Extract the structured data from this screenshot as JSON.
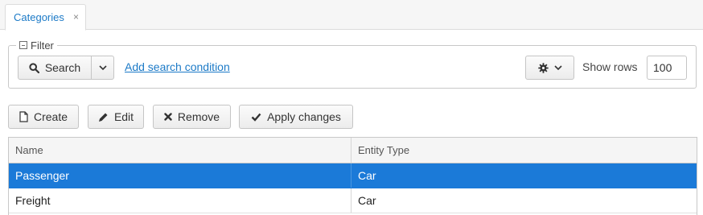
{
  "tab": {
    "label": "Categories",
    "close_glyph": "×"
  },
  "filter": {
    "legend": "Filter",
    "search_button": "Search",
    "add_condition_link": "Add search condition",
    "show_rows_label": "Show rows",
    "rows_value": "100"
  },
  "toolbar": {
    "create": "Create",
    "edit": "Edit",
    "remove": "Remove",
    "apply": "Apply changes"
  },
  "table": {
    "columns": [
      "Name",
      "Entity Type"
    ],
    "rows": [
      {
        "name": "Passenger",
        "entity_type": "Car",
        "selected": true
      },
      {
        "name": "Freight",
        "entity_type": "Car",
        "selected": false
      }
    ]
  },
  "colors": {
    "accent": "#1c7ac7",
    "selection": "#1b7ad8"
  },
  "icons": [
    "collapse-icon",
    "search-icon",
    "chevron-down-icon",
    "gear-icon",
    "document-icon",
    "pencil-icon",
    "x-icon",
    "checkmark-icon"
  ]
}
